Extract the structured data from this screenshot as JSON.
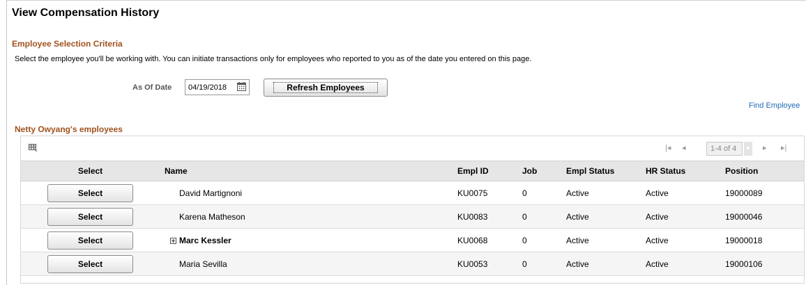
{
  "page": {
    "title": "View Compensation History"
  },
  "criteria": {
    "title": "Employee Selection Criteria",
    "instructions": "Select the employee you'll be working with. You can initiate transactions only for employees who reported to you as of the date you entered on this page.",
    "as_of_label": "As Of Date",
    "as_of_value": "04/19/2018",
    "refresh_label": "Refresh Employees",
    "find_employee": "Find Employee"
  },
  "grid": {
    "title": "Netty Owyang's employees",
    "pager": {
      "range": "1-4 of 4"
    },
    "columns": [
      "Select",
      "Name",
      "Empl ID",
      "Job",
      "Empl Status",
      "HR Status",
      "Position"
    ],
    "rows": [
      {
        "select_label": "Select",
        "name": "David Martignoni",
        "empl_id": "KU0075",
        "job": "0",
        "empl_status": "Active",
        "hr_status": "Active",
        "position": "19000089"
      },
      {
        "select_label": "Select",
        "name": "Karena Matheson",
        "empl_id": "KU0083",
        "job": "0",
        "empl_status": "Active",
        "hr_status": "Active",
        "position": "19000046"
      },
      {
        "select_label": "Select",
        "name": "Marc Kessler",
        "empl_id": "KU0068",
        "job": "0",
        "empl_status": "Active",
        "hr_status": "Active",
        "position": "19000018"
      },
      {
        "select_label": "Select",
        "name": "Maria Sevilla",
        "empl_id": "KU0053",
        "job": "0",
        "empl_status": "Active",
        "hr_status": "Active",
        "position": "19000106"
      }
    ]
  },
  "colors": {
    "section_title": "#a0521d",
    "link": "#1e6bb8",
    "header_bg": "#e6e6e6"
  },
  "icons": {
    "calendar": "calendar-icon",
    "grid": "grid-personalize-icon",
    "expand": "expand-plus-icon"
  }
}
